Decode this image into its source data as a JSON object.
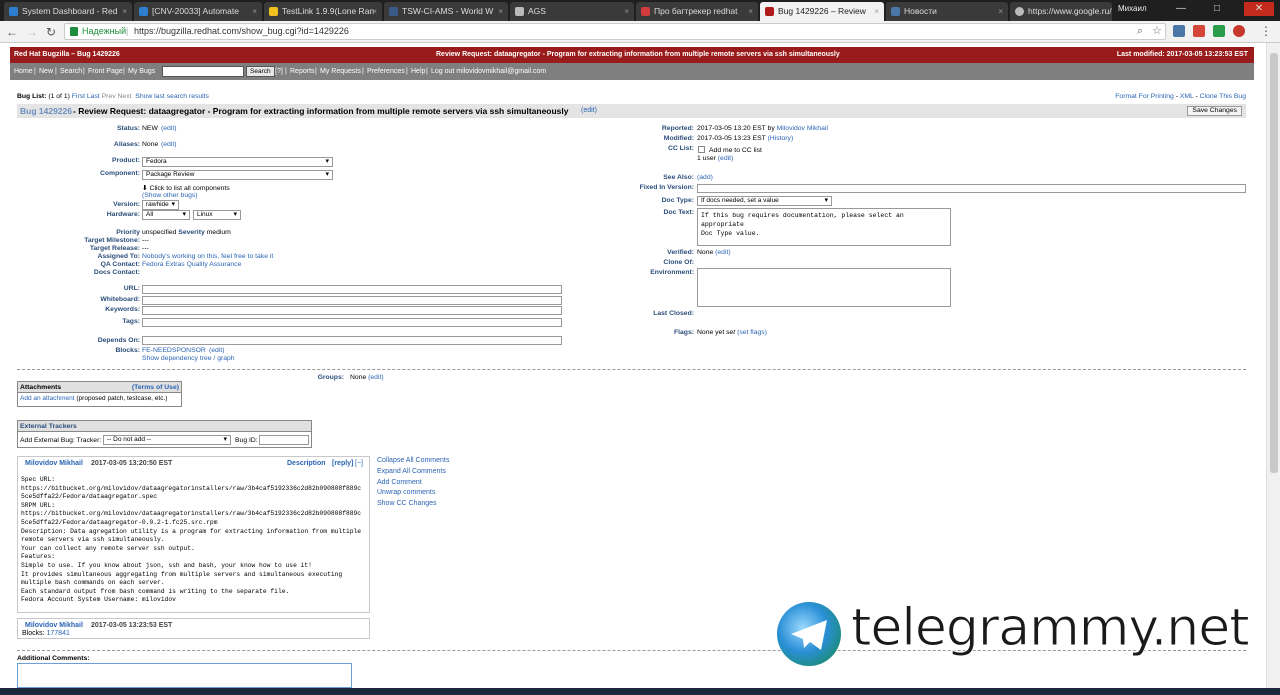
{
  "browser": {
    "tabs": [
      {
        "label": "System Dashboard - Red",
        "icon_color": "#2f7fd1"
      },
      {
        "label": "[CNV-20033] Automate",
        "icon_color": "#2f7fd1"
      },
      {
        "label": "TestLink 1.9.9(Lone Ran",
        "icon_color": "#f0c020"
      },
      {
        "label": "TSW-CI-AMS - World W",
        "icon_color": "#3a5a8a"
      },
      {
        "label": "AGS",
        "icon_color": "#bbbbbb"
      },
      {
        "label": "Про багтрекер redhat",
        "icon_color": "#d23c3c"
      },
      {
        "label": "Bug 1429226 – Review",
        "icon_color": "#b01c1c"
      },
      {
        "label": "Новости",
        "icon_color": "#4a76a8"
      },
      {
        "label": "https://www.google.ru/",
        "icon_color": "#bbbbbb"
      }
    ],
    "user_name": "Михаил",
    "secure_label": "Надежный",
    "url": "https://bugzilla.redhat.com/show_bug.cgi?id=1429226",
    "win_min": "—",
    "win_max": "□",
    "win_close": "✕",
    "back": "←",
    "forward": "→",
    "reload": "↻",
    "star": "☆",
    "menu": "⋮",
    "tab_close": "×"
  },
  "bz": {
    "product_title": "Red Hat Bugzilla – Bug 1429226",
    "header_summary": "Review Request: dataagregator - Program for extracting information from multiple remote servers via ssh simultaneously",
    "last_modified": "Last modified: 2017-03-05 13:23:53 EST",
    "nav": {
      "home": "Home",
      "new": "New",
      "search": "Search",
      "front_page": "Front Page",
      "my_bugs": "My Bugs",
      "search_btn": "Search",
      "help_q": "[?]",
      "reports": "Reports",
      "my_requests": "My Requests",
      "preferences": "Preferences",
      "help": "Help",
      "logout": "Log out milovidovmikhail@gmail.com",
      "sep": "|"
    },
    "buglist": {
      "label": "Bug List:",
      "count": "(1 of 1)",
      "first": "First",
      "last": "Last",
      "prev": "Prev",
      "next": "Next",
      "show_last": "Show last search results"
    },
    "top_right": {
      "printing": "Format For Printing",
      "xml": "XML",
      "clone": "Clone This Bug",
      "sep": " - "
    },
    "title": {
      "bug_link": "Bug 1429226",
      "summary": " - Review Request: dataagregator - Program for extracting information from multiple remote servers via ssh simultaneously",
      "edit": "(edit)",
      "save": "Save Changes"
    },
    "left": {
      "status_l": "Status:",
      "status_v": "NEW",
      "status_e": "(edit)",
      "aliases_l": "Aliases:",
      "aliases_v": "None",
      "aliases_e": "(edit)",
      "product_l": "Product:",
      "product_v": "Fedora",
      "component_l": "Component:",
      "component_v": "Package Review",
      "click_list": "Click to list all components",
      "show_other": "(Show other bugs)",
      "version_l": "Version:",
      "version_v": "rawhide",
      "hardware_l": "Hardware:",
      "hardware_v": "All",
      "os_v": "Linux",
      "priority_l": "Priority",
      "priority_v": "unspecified",
      "severity_l": "Severity",
      "severity_v": "medium",
      "milestone_l": "Target Milestone:",
      "milestone_v": "---",
      "release_l": "Target Release:",
      "release_v": "---",
      "assigned_l": "Assigned To:",
      "assigned_v": "Nobody's working on this, feel free to take it",
      "qa_l": "QA Contact:",
      "qa_v": "Fedora Extras Quality Assurance",
      "docs_l": "Docs Contact:",
      "url_l": "URL:",
      "whiteboard_l": "Whiteboard:",
      "keywords_l": "Keywords:",
      "tags_l": "Tags:",
      "depends_l": "Depends On:",
      "blocks_l": "Blocks:",
      "blocks_v": "FE-NEEDSPONSOR",
      "blocks_e": "(edit)",
      "dep_tree": "Show dependency tree / graph"
    },
    "right": {
      "reported_l": "Reported:",
      "reported_v": "2017-03-05 13:20 EST by",
      "reported_by": "Milovidov Mikhail",
      "modified_l": "Modified:",
      "modified_v": "2017-03-05 13:23 EST",
      "history": "(History)",
      "cc_l": "CC List:",
      "cc_add": "Add me to CC list",
      "cc_users": "1 user",
      "cc_edit": "(edit)",
      "seealso_l": "See Also:",
      "seealso_e": "(add)",
      "fixed_l": "Fixed In Version:",
      "doctype_l": "Doc Type:",
      "doctype_v": "If docs needed, set a value",
      "doctext_l": "Doc Text:",
      "doctext_v": "If this bug requires documentation, please select an appropriate\nDoc Type value.",
      "verified_l": "Verified:",
      "verified_v": "None",
      "verified_e": "(edit)",
      "cloneof_l": "Clone Of:",
      "env_l": "Environment:",
      "lastclosed_l": "Last Closed:",
      "flags_l": "Flags:",
      "flags_v": "None yet",
      "flags_set": "set",
      "flags_e": "(set flags)"
    },
    "groups_l": "Groups:",
    "groups_v": "None",
    "groups_e": "(edit)",
    "attachments": {
      "title": "Attachments",
      "terms": "(Terms of Use)",
      "add": "Add an attachment",
      "hint": "(proposed patch, testcase, etc.)"
    },
    "external": {
      "title": "External Trackers",
      "add_label": "Add External Bug: Tracker:",
      "tracker_v": "-- Do not add --",
      "bugid_l": "Bug ID:"
    },
    "comment0": {
      "author": "Milovidov Mikhail",
      "time": "2017-03-05 13:20:50 EST",
      "desc": "Description",
      "reply": "[reply]",
      "collapse": "[−]",
      "body": "Spec URL:\nhttps://bitbucket.org/milovidov/dataagregatorinstallers/raw/3b4caf5192336c2d82b090808f889c\n5ce5dffa22/Fedora/dataagregator.spec\nSRPM URL:\nhttps://bitbucket.org/milovidov/dataagregatorinstallers/raw/3b4caf5192336c2d82b090808f889c\n5ce5dffa22/Fedora/dataagregator-0.0.2-1.fc25.src.rpm\nDescription: Data agregation utility is a program for extracting information from multiple\nremote servers via ssh simultaneously.\nYour can collect any remote server ssh output.\nFeatures:\nSimple to use. If you know about json, ssh and bash, your know how to use it!\nIt provides simultaneous aggregating from multiple servers and simultaneous executing\nmultiple bash commands on each server.\nEach standard output from bash command is writing to the separate file.\nFedora Account System Username: milovidov"
    },
    "comment1": {
      "author": "Milovidov Mikhail",
      "time": "2017-03-05 13:23:53 EST",
      "blocks_l": "Blocks:",
      "blocks_v": "177841"
    },
    "side_links": [
      "Collapse All Comments",
      "Expand All Comments",
      "Add Comment",
      "Unwrap comments",
      "Show CC Changes"
    ],
    "additional_comments": "Additional Comments:"
  },
  "watermark": "telegrammy.net"
}
